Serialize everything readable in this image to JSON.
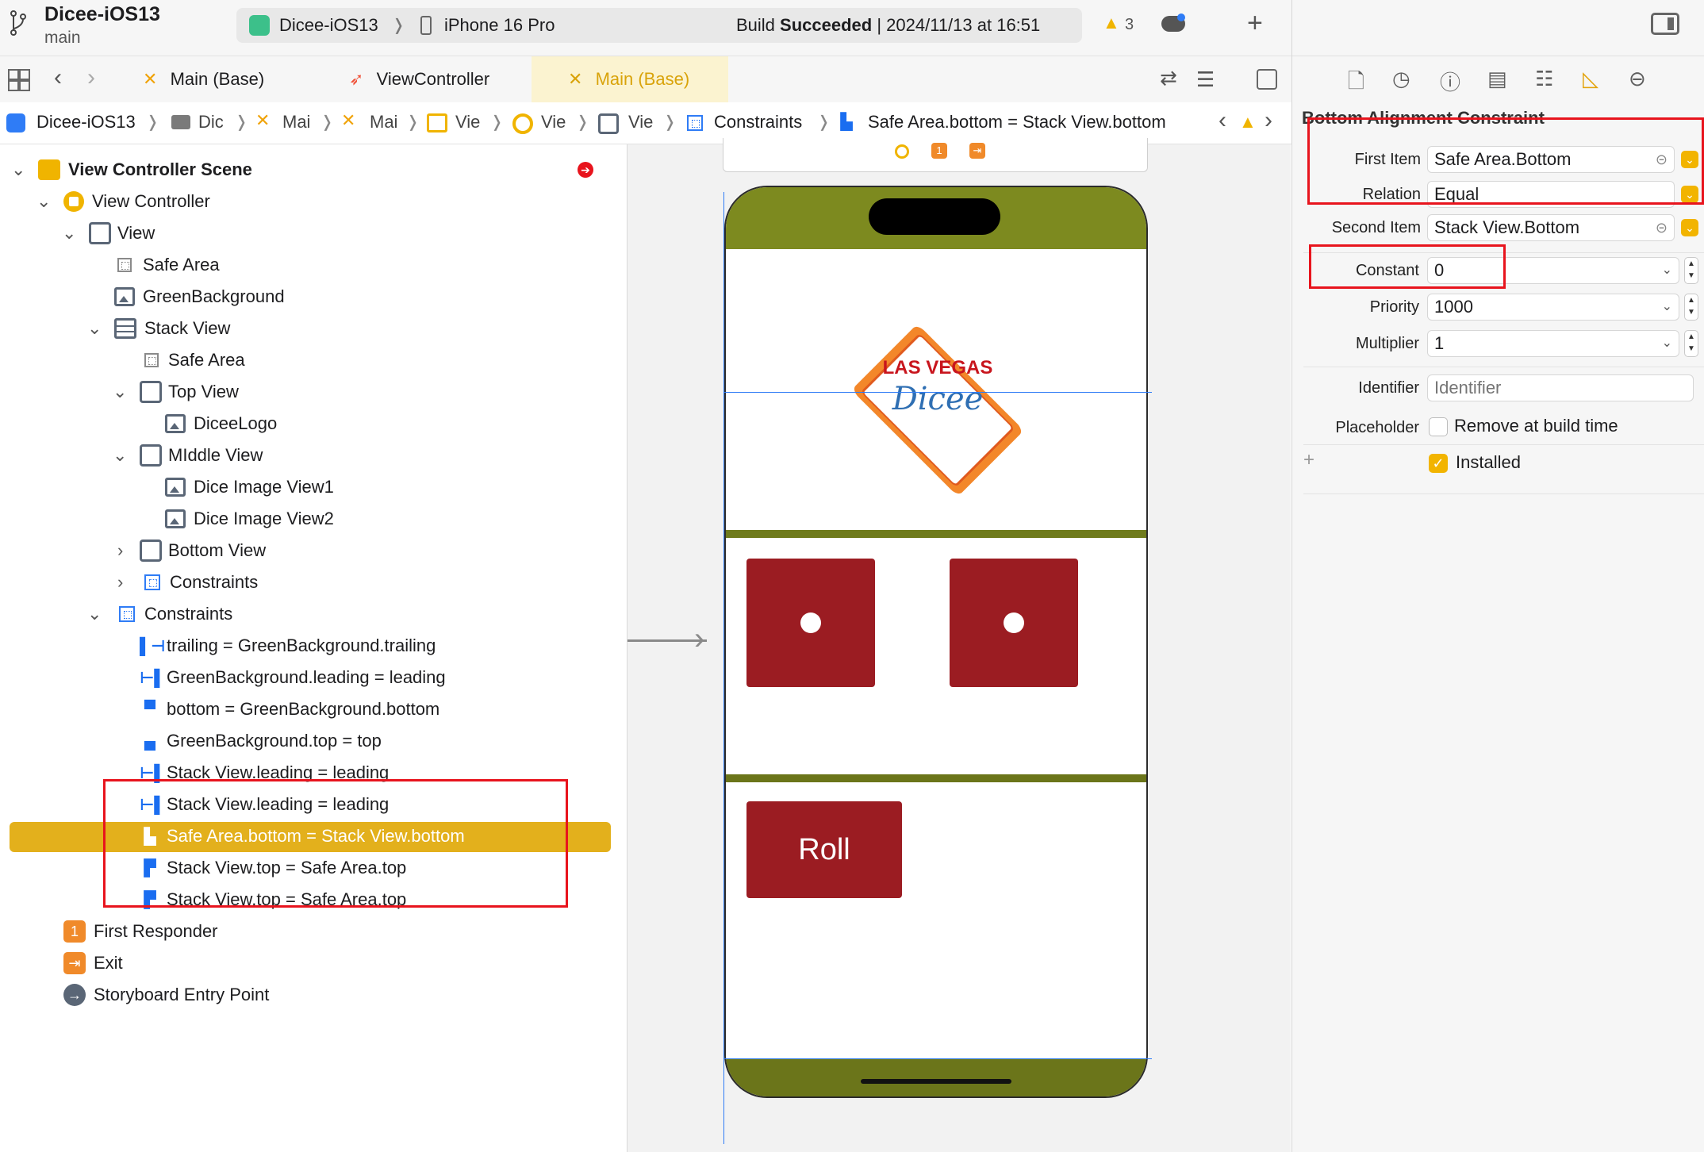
{
  "toolbar": {
    "project_name": "Dicee-iOS13",
    "branch": "main",
    "scheme": "Dicee-iOS13",
    "device": "iPhone 16 Pro",
    "status_prefix": "Build ",
    "status_strong": "Succeeded",
    "status_suffix": " | 2024/11/13 at 16:51",
    "warning_count": "3"
  },
  "tabs": [
    {
      "label": "Main (Base)"
    },
    {
      "label": "ViewController"
    },
    {
      "label": "Main (Base)"
    }
  ],
  "jump_bar": {
    "items": [
      "Dicee-iOS13",
      "Dic",
      "Mai",
      "Mai",
      "Vie",
      "Vie",
      "Vie",
      "Constraints",
      "Safe Area.bottom = Stack View.bottom"
    ]
  },
  "outline": {
    "scene": "View Controller Scene",
    "view_controller": "View Controller",
    "view": "View",
    "safe_area": "Safe Area",
    "green_background": "GreenBackground",
    "stack_view": "Stack View",
    "stack_safe_area": "Safe Area",
    "top_view": "Top View",
    "dicee_logo": "DiceeLogo",
    "middle_view": "MIddle View",
    "dice1": "Dice Image View1",
    "dice2": "Dice Image View2",
    "bottom_view": "Bottom View",
    "stack_constraints": "Constraints",
    "constraints": "Constraints",
    "c1": "trailing = GreenBackground.trailing",
    "c2": "GreenBackground.leading = leading",
    "c3": "bottom = GreenBackground.bottom",
    "c4": "GreenBackground.top = top",
    "c5": "Stack View.leading = leading",
    "c6": "Stack View.leading = leading",
    "c7": "Safe Area.bottom = Stack View.bottom",
    "c8": "Stack View.top = Safe Area.top",
    "c9": "Stack View.top = Safe Area.top",
    "first_responder": "First Responder",
    "exit": "Exit",
    "entry_point": "Storyboard Entry Point"
  },
  "canvas": {
    "logo_line1": "LAS VEGAS",
    "logo_line2": "Dicee",
    "roll_label": "Roll"
  },
  "inspector": {
    "title": "Bottom Alignment Constraint",
    "first_item_label": "First Item",
    "first_item_value": "Safe Area.Bottom",
    "relation_label": "Relation",
    "relation_value": "Equal",
    "second_item_label": "Second Item",
    "second_item_value": "Stack View.Bottom",
    "constant_label": "Constant",
    "constant_value": "0",
    "priority_label": "Priority",
    "priority_value": "1000",
    "multiplier_label": "Multiplier",
    "multiplier_value": "1",
    "identifier_label": "Identifier",
    "identifier_placeholder": "Identifier",
    "placeholder_label": "Placeholder",
    "placeholder_checkbox": "Remove at build time",
    "installed_label": "Installed"
  },
  "colors": {
    "accent_yellow": "#e3b01c",
    "annotation_red": "#e8141d",
    "dice_red": "#9b1c22",
    "green_bg": "#7d8a1f",
    "xcode_blue": "#1a6df0"
  }
}
